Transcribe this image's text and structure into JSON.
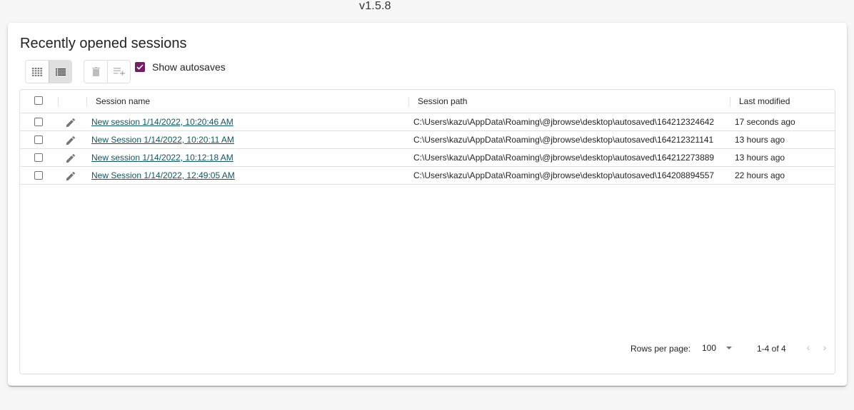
{
  "version": "v1.5.8",
  "title": "Recently opened sessions",
  "toolbar": {
    "grid_view_icon": "grid-icon",
    "list_view_icon": "list-icon",
    "delete_icon": "delete-icon",
    "add_to_list_icon": "playlist-add-icon",
    "show_autosaves_label": "Show autosaves",
    "show_autosaves_checked": true
  },
  "columns": {
    "name": "Session name",
    "path": "Session path",
    "modified": "Last modified"
  },
  "rows": [
    {
      "name": "New session 1/14/2022, 10:20:46 AM",
      "path": "C:\\Users\\kazu\\AppData\\Roaming\\@jbrowse\\desktop\\autosaved\\164212324642",
      "modified": "17 seconds ago"
    },
    {
      "name": "New Session 1/14/2022, 10:20:11 AM",
      "path": "C:\\Users\\kazu\\AppData\\Roaming\\@jbrowse\\desktop\\autosaved\\164212321141",
      "modified": "13 hours ago"
    },
    {
      "name": "New session 1/14/2022, 10:12:18 AM",
      "path": "C:\\Users\\kazu\\AppData\\Roaming\\@jbrowse\\desktop\\autosaved\\164212273889",
      "modified": "13 hours ago"
    },
    {
      "name": "New Session 1/14/2022, 12:49:05 AM",
      "path": "C:\\Users\\kazu\\AppData\\Roaming\\@jbrowse\\desktop\\autosaved\\164208894557",
      "modified": "22 hours ago"
    }
  ],
  "footer": {
    "rows_per_page_label": "Rows per page:",
    "rows_per_page_value": "100",
    "range": "1-4 of 4",
    "prev": "‹",
    "next": "›"
  },
  "colors": {
    "accent": "#721e63",
    "link": "#135560"
  }
}
